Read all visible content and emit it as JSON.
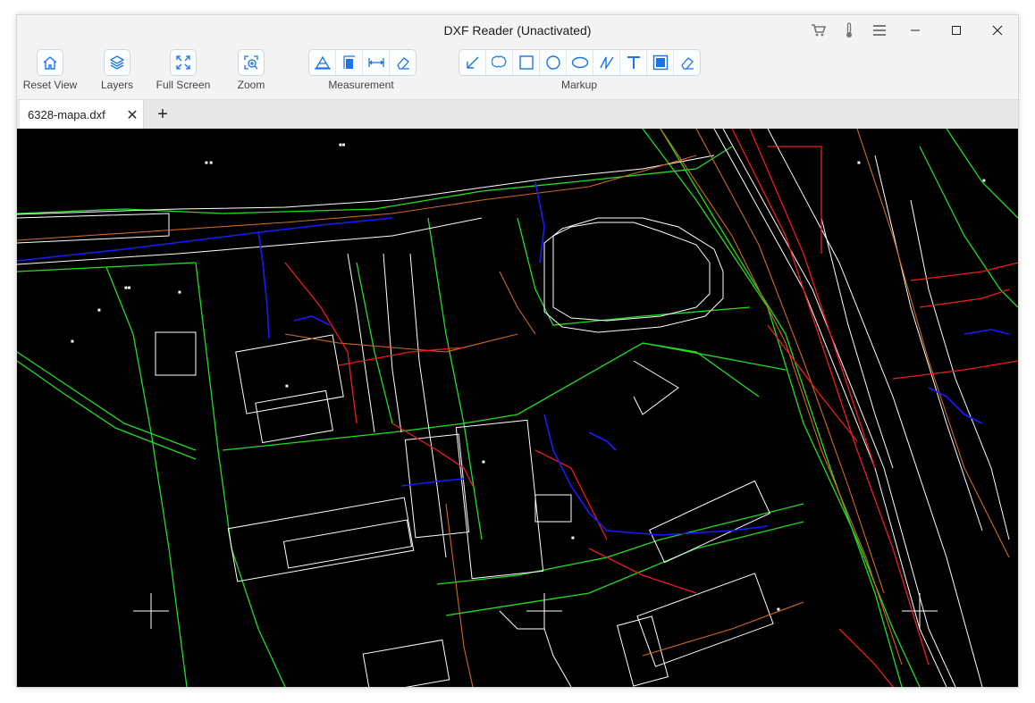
{
  "window": {
    "title": "DXF Reader (Unactivated)"
  },
  "title_icons": [
    "cart-icon",
    "thermometer-icon",
    "menu-icon"
  ],
  "window_controls": [
    "minimize-icon",
    "maximize-icon",
    "close-icon"
  ],
  "toolbar": {
    "reset_view": "Reset View",
    "layers": "Layers",
    "full_screen": "Full Screen",
    "zoom": "Zoom",
    "measurement_label": "Measurement",
    "measurement_tools": [
      "area-measure-icon",
      "height-measure-icon",
      "distance-measure-icon",
      "eraser-icon"
    ],
    "markup_label": "Markup",
    "markup_tools": [
      "arrow-icon",
      "cloud-icon",
      "rectangle-icon",
      "circle-icon",
      "ellipse-icon",
      "polyline-icon",
      "text-icon",
      "fill-icon",
      "eraser-icon"
    ]
  },
  "tabs": [
    {
      "label": "6328-mapa.dxf",
      "active": true
    }
  ],
  "colors": {
    "accent": "#1a73e8",
    "canvas_bg": "#000000",
    "cad_white": "#ffffff",
    "cad_green": "#22dd22",
    "cad_red": "#ee1c1c",
    "cad_blue": "#1a1aff",
    "cad_orange": "#d2691e"
  }
}
